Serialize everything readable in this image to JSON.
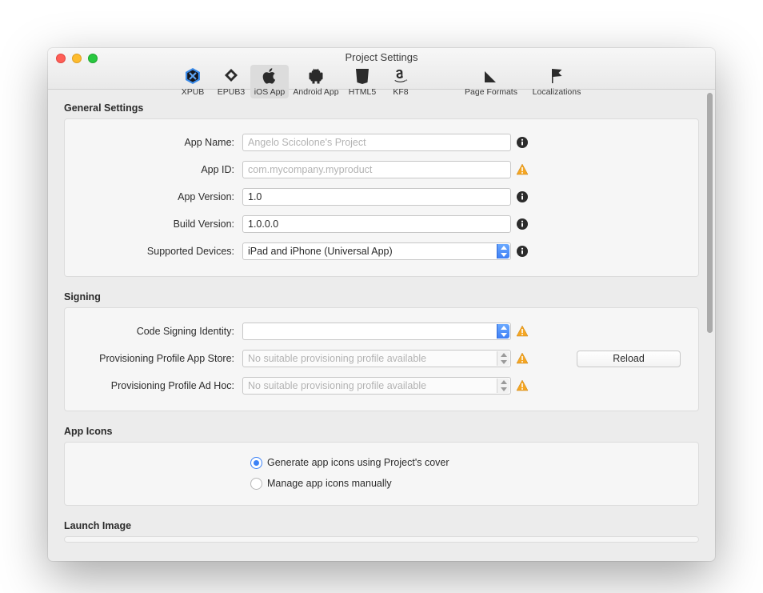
{
  "window": {
    "title": "Project Settings"
  },
  "toolbar": [
    {
      "id": "xpub",
      "label": "XPUB"
    },
    {
      "id": "epub3",
      "label": "EPUB3"
    },
    {
      "id": "ios",
      "label": "iOS App",
      "selected": true
    },
    {
      "id": "android",
      "label": "Android App"
    },
    {
      "id": "html5",
      "label": "HTML5"
    },
    {
      "id": "kf8",
      "label": "KF8"
    },
    {
      "id": "pageformats",
      "label": "Page Formats",
      "wide": true
    },
    {
      "id": "localizations",
      "label": "Localizations",
      "wide": true
    }
  ],
  "sections": {
    "general": {
      "title": "General Settings",
      "appName": {
        "label": "App Name:",
        "placeholder": "Angelo Scicolone's Project",
        "value": ""
      },
      "appId": {
        "label": "App ID:",
        "placeholder": "com.mycompany.myproduct",
        "value": ""
      },
      "appVersion": {
        "label": "App Version:",
        "value": "1.0"
      },
      "buildVersion": {
        "label": "Build Version:",
        "value": "1.0.0.0"
      },
      "supportedDevices": {
        "label": "Supported Devices:",
        "value": "iPad and iPhone (Universal App)"
      }
    },
    "signing": {
      "title": "Signing",
      "identity": {
        "label": "Code Signing Identity:",
        "value": ""
      },
      "profileAppStore": {
        "label": "Provisioning Profile App Store:",
        "placeholder": "No suitable provisioning profile available"
      },
      "profileAdHoc": {
        "label": "Provisioning Profile Ad Hoc:",
        "placeholder": "No suitable provisioning profile available"
      },
      "reload": "Reload"
    },
    "icons": {
      "title": "App Icons",
      "optGenerate": "Generate app icons using Project's cover",
      "optManual": "Manage app icons manually"
    },
    "launch": {
      "title": "Launch Image"
    }
  }
}
